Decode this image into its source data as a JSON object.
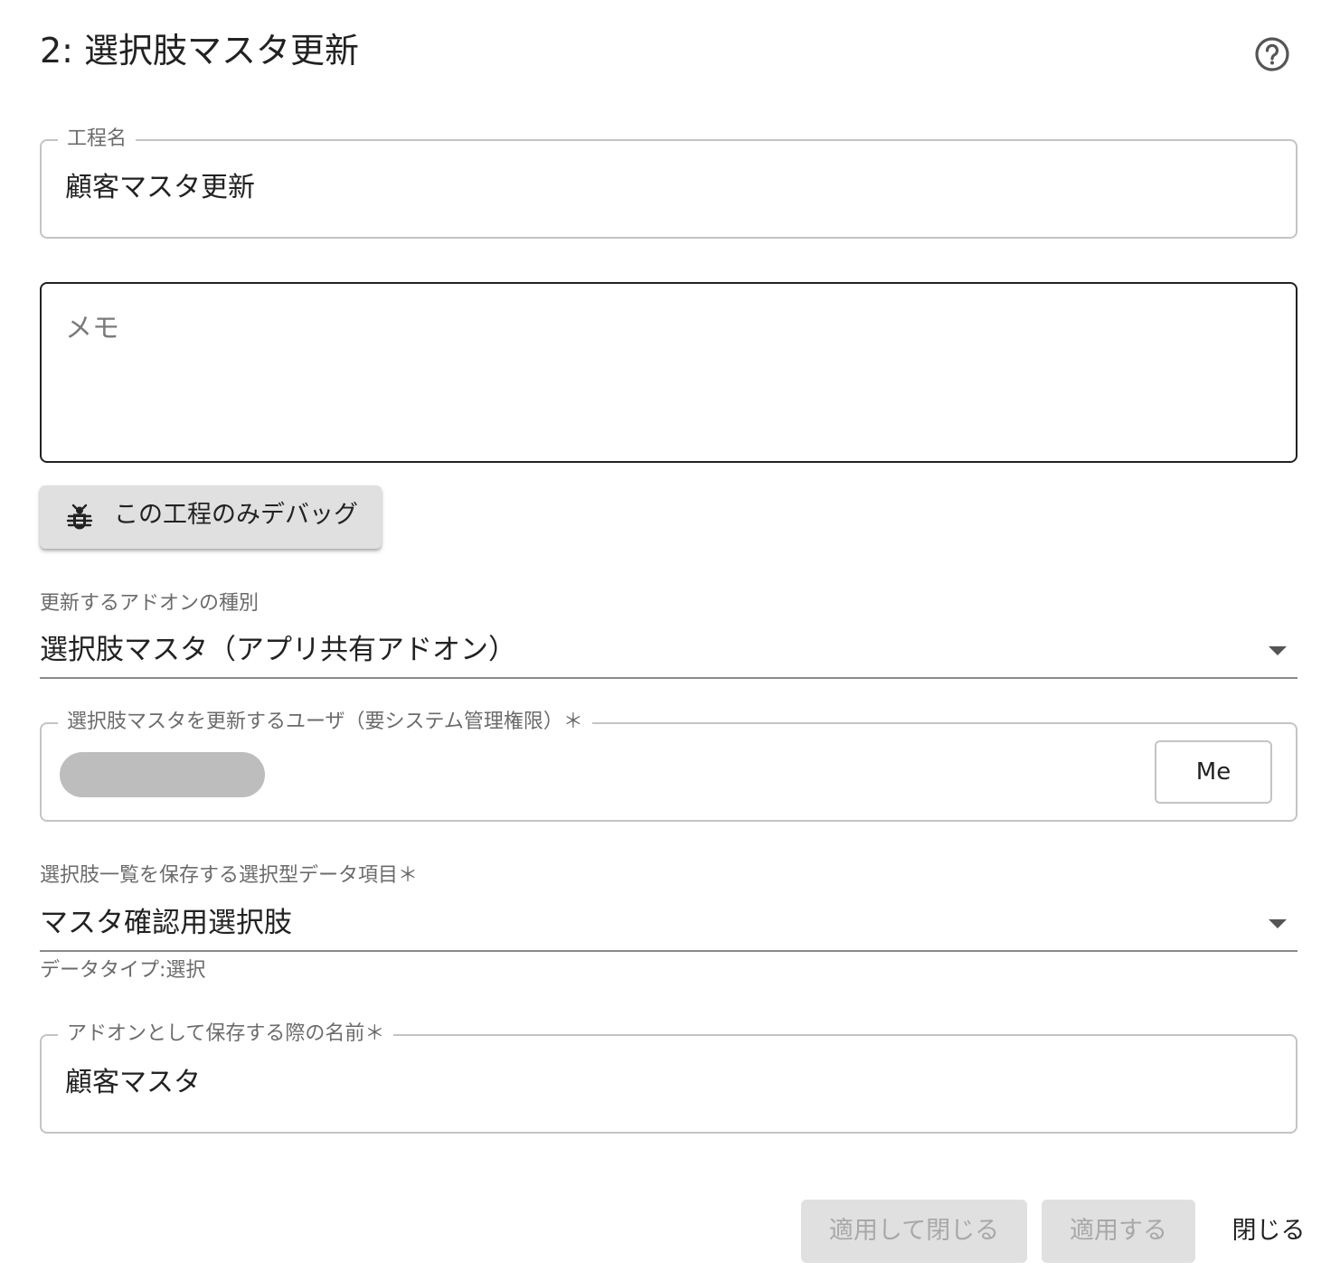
{
  "header": {
    "title": "2: 選択肢マスタ更新",
    "help_icon": "help-circle-icon"
  },
  "step_name": {
    "label": "工程名",
    "value": "顧客マスタ更新"
  },
  "memo": {
    "placeholder": "メモ",
    "value": ""
  },
  "debug_button": {
    "icon": "bug-icon",
    "label": "この工程のみデバッグ"
  },
  "addon_type": {
    "label": "更新するアドオンの種別",
    "value": "選択肢マスタ（アプリ共有アドオン）"
  },
  "update_user": {
    "label": "選択肢マスタを更新するユーザ（要システム管理権限）＊",
    "me_label": "Me"
  },
  "choice_item": {
    "label": "選択肢一覧を保存する選択型データ項目＊",
    "value": "マスタ確認用選択肢",
    "helper": "データタイプ:選択"
  },
  "addon_name": {
    "label": "アドオンとして保存する際の名前＊",
    "value": "顧客マスタ"
  },
  "footer": {
    "apply_close_label": "適用して閉じる",
    "apply_label": "適用する",
    "close_label": "閉じる"
  },
  "colors": {
    "disabled_bg": "#e0e0e0",
    "disabled_text": "#a8a8a8",
    "outline": "#c4c4c4",
    "focused_outline": "#222222"
  }
}
